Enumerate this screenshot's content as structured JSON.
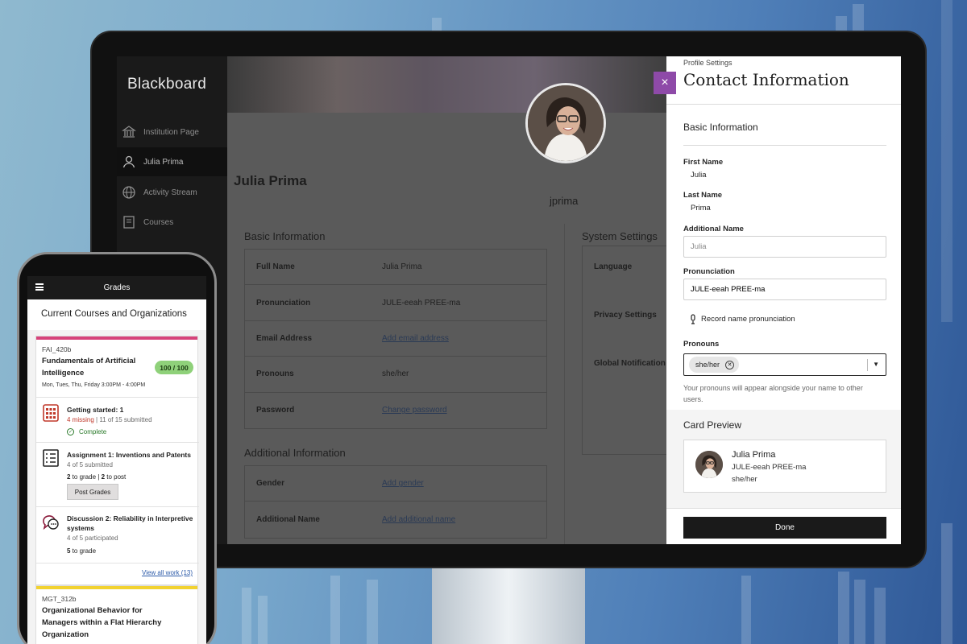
{
  "desktop": {
    "logo": "Blackboard",
    "nav": [
      {
        "label": "Institution Page",
        "icon": "institution-icon"
      },
      {
        "label": "Julia Prima",
        "icon": "user-icon"
      },
      {
        "label": "Activity Stream",
        "icon": "globe-icon"
      },
      {
        "label": "Courses",
        "icon": "courses-icon"
      }
    ],
    "profile": {
      "name": "Julia Prima",
      "username": "jprima",
      "basic_info_heading": "Basic Information",
      "basic_rows": [
        {
          "label": "Full Name",
          "value": "Julia Prima",
          "link": false
        },
        {
          "label": "Pronunciation",
          "value": "JULE-eeah PREE-ma",
          "link": false
        },
        {
          "label": "Email Address",
          "value": "Add email address",
          "link": true
        },
        {
          "label": "Pronouns",
          "value": "she/her",
          "link": false
        },
        {
          "label": "Password",
          "value": "Change password",
          "link": true
        }
      ],
      "additional_heading": "Additional Information",
      "additional_rows": [
        {
          "label": "Gender",
          "value": "Add gender",
          "link": true
        },
        {
          "label": "Additional Name",
          "value": "Add additional name",
          "link": true
        }
      ],
      "system_heading": "System Settings",
      "system_rows": [
        "Language",
        "Privacy Settings",
        "Global Notification"
      ]
    },
    "panel": {
      "close_symbol": "×",
      "breadcrumb": "Profile Settings",
      "title": "Contact Information",
      "section_heading": "Basic Information",
      "first_name_label": "First Name",
      "first_name": "Julia",
      "last_name_label": "Last Name",
      "last_name": "Prima",
      "additional_name_label": "Additional Name",
      "additional_name_placeholder": "Julia",
      "pronunciation_label": "Pronunciation",
      "pronunciation_value": "JULE-eeah PREE-ma",
      "record_label": "Record name pronunciation",
      "pronouns_label": "Pronouns",
      "pronoun_chip": "she/her",
      "pronouns_hint": "Your pronouns will appear alongside your name to other users.",
      "card_preview_heading": "Card Preview",
      "card": {
        "name": "Julia Prima",
        "pronunciation": "JULE-eeah PREE-ma",
        "pronouns": "she/her"
      },
      "done_label": "Done"
    }
  },
  "phone": {
    "title": "Grades",
    "heading": "Current Courses and Organizations",
    "course1": {
      "code": "FAI_420b",
      "title": "Fundamentals of Artificial Intelligence",
      "schedule": "Mon, Tues, Thu, Friday 3:00PM - 4:00PM",
      "grade": "100 / 100",
      "accent": "#d6437a",
      "items": [
        {
          "title": "Getting started: 1",
          "missing": "4 missing",
          "sep": " | ",
          "submitted": "11 of 15 submitted",
          "status": "Complete"
        },
        {
          "title": "Assignment 1: Inventions and Patents",
          "sub": "4 of 5 submitted",
          "grade_n": "2",
          "grade_t": " to grade ",
          "post_n": "2",
          "post_t": " to post",
          "sep": "|",
          "button": "Post Grades"
        },
        {
          "title": "Discussion 2: Reliability in Interpretive systems",
          "sub": "4 of 5 participated",
          "grade_n": "5",
          "grade_t": " to grade"
        }
      ],
      "view_all": "View all work (13)"
    },
    "course2": {
      "code": "MGT_312b",
      "title": "Organizational Behavior for Managers within a Flat Hierarchy Organization",
      "accent": "#f2d230"
    }
  },
  "colors": {
    "accent_purple": "#8e4aa8",
    "pill_green": "#8fd17a"
  }
}
